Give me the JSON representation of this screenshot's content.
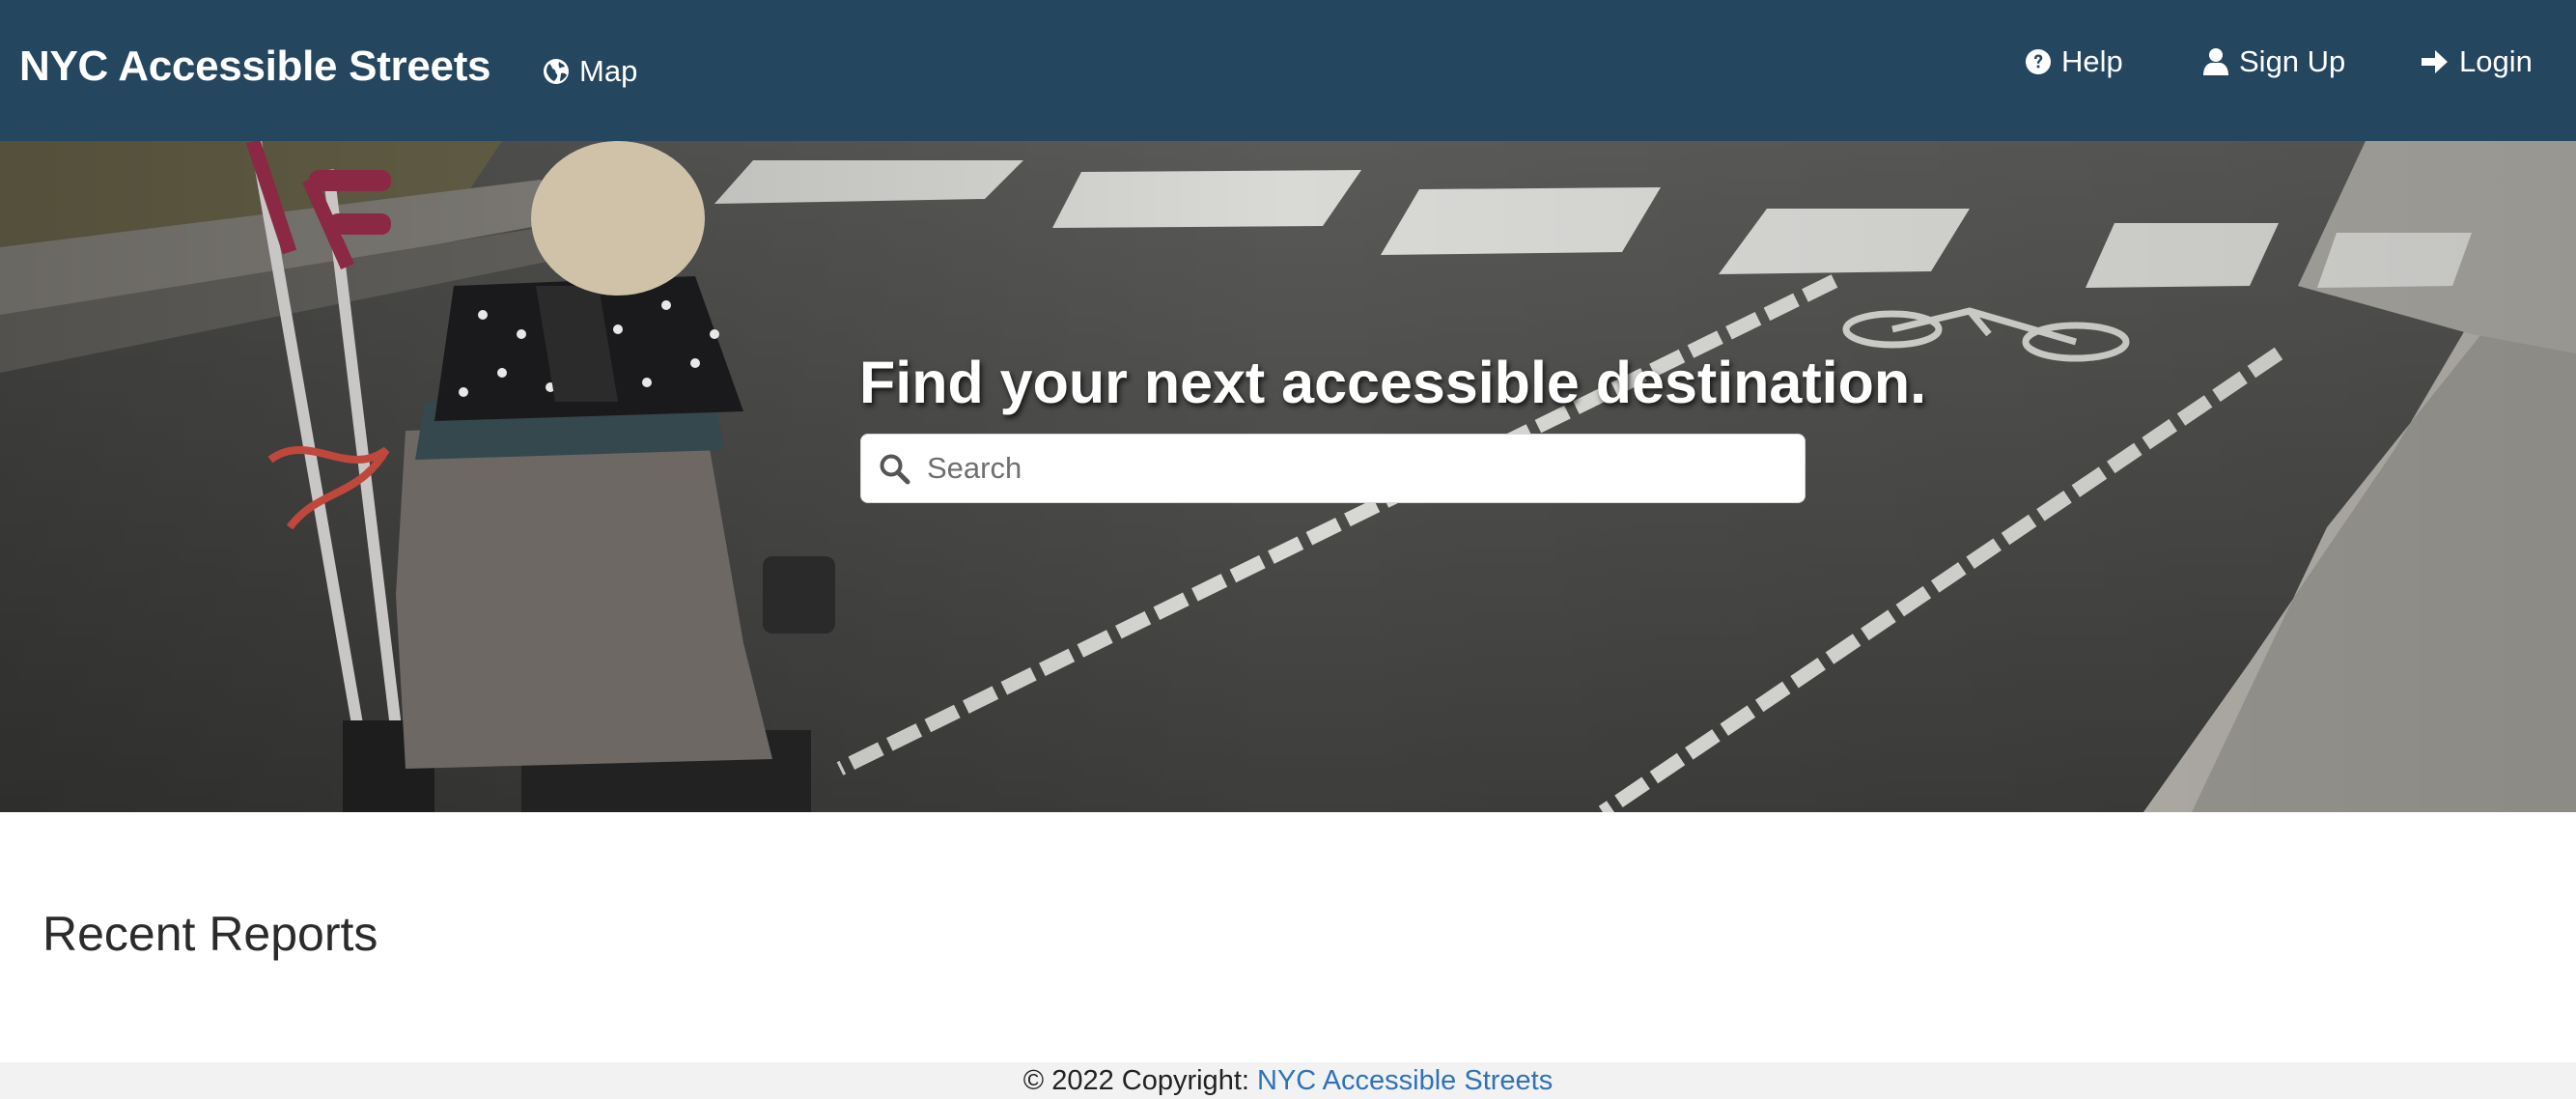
{
  "navbar": {
    "brand": "NYC Accessible Streets",
    "map_label": "Map",
    "help_label": "Help",
    "signup_label": "Sign Up",
    "login_label": "Login",
    "background_color": "#24465f"
  },
  "hero": {
    "title": "Find your next accessible destination.",
    "search_placeholder": "Search"
  },
  "main": {
    "recent_reports_heading": "Recent Reports"
  },
  "footer": {
    "copyright_text": "© 2022 Copyright: ",
    "link_text": "NYC Accessible Streets",
    "link_color": "#2f72b8"
  },
  "icons": {
    "map": "globe-icon",
    "help": "question-circle-icon",
    "signup": "user-icon",
    "login": "sign-in-arrow-icon",
    "search": "search-icon"
  }
}
